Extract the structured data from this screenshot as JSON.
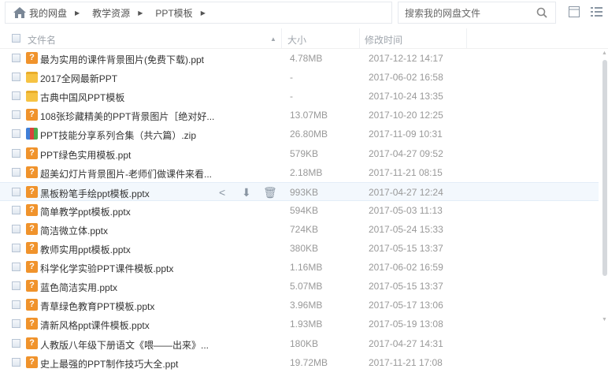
{
  "breadcrumb": [
    "我的网盘",
    "教学资源",
    "PPT模板"
  ],
  "search": {
    "placeholder": "搜索我的网盘文件"
  },
  "columns": {
    "name": "文件名",
    "size": "大小",
    "mtime": "修改时间"
  },
  "files": [
    {
      "name": "最为实用的课件背景图片(免费下载).ppt",
      "type": "ppt",
      "size": "4.78MB",
      "mtime": "2017-12-12 14:17"
    },
    {
      "name": "2017全网最新PPT",
      "type": "folder",
      "size": "-",
      "mtime": "2017-06-02 16:58"
    },
    {
      "name": "古典中国风PPT模板",
      "type": "folder",
      "size": "-",
      "mtime": "2017-10-24 13:35"
    },
    {
      "name": "108张珍藏精美的PPT背景图片［绝对好...",
      "type": "ppt",
      "size": "13.07MB",
      "mtime": "2017-10-20 12:25"
    },
    {
      "name": "PPT技能分享系列合集（共六篇）.zip",
      "type": "zip",
      "size": "26.80MB",
      "mtime": "2017-11-09 10:31"
    },
    {
      "name": "PPT绿色实用模板.ppt",
      "type": "ppt",
      "size": "579KB",
      "mtime": "2017-04-27 09:52"
    },
    {
      "name": "超美幻灯片背景图片-老师们做课件来看...",
      "type": "ppt",
      "size": "2.18MB",
      "mtime": "2017-11-21 08:15"
    },
    {
      "name": "黑板粉笔手绘ppt模板.pptx",
      "type": "ppt",
      "size": "993KB",
      "mtime": "2017-04-27 12:24",
      "hover": true
    },
    {
      "name": "简单教学ppt模板.pptx",
      "type": "ppt",
      "size": "594KB",
      "mtime": "2017-05-03 11:13"
    },
    {
      "name": "简洁微立体.pptx",
      "type": "ppt",
      "size": "724KB",
      "mtime": "2017-05-24 15:33"
    },
    {
      "name": "教师实用ppt模板.pptx",
      "type": "ppt",
      "size": "380KB",
      "mtime": "2017-05-15 13:37"
    },
    {
      "name": "科学化学实验PPT课件模板.pptx",
      "type": "ppt",
      "size": "1.16MB",
      "mtime": "2017-06-02 16:59"
    },
    {
      "name": "蓝色简洁实用.pptx",
      "type": "ppt",
      "size": "5.07MB",
      "mtime": "2017-05-15 13:37"
    },
    {
      "name": "青草绿色教育PPT模板.pptx",
      "type": "ppt",
      "size": "3.96MB",
      "mtime": "2017-05-17 13:06"
    },
    {
      "name": "清新风格ppt课件模板.pptx",
      "type": "ppt",
      "size": "1.93MB",
      "mtime": "2017-05-19 13:08"
    },
    {
      "name": "人教版八年级下册语文《喂——出来》...",
      "type": "ppt",
      "size": "180KB",
      "mtime": "2017-04-27 14:31"
    },
    {
      "name": "史上最强的PPT制作技巧大全.ppt",
      "type": "ppt",
      "size": "19.72MB",
      "mtime": "2017-11-21 17:08"
    }
  ]
}
